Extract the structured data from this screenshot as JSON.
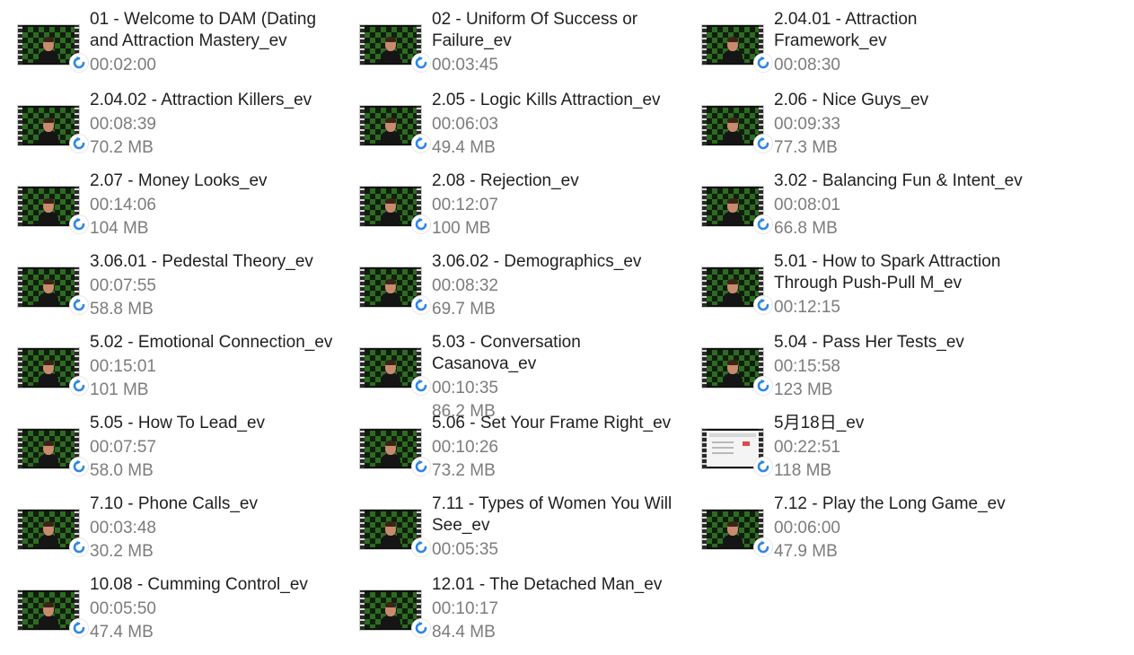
{
  "files": [
    {
      "name": "01 - Welcome to DAM (Dating and Attraction Mastery_ev",
      "duration": "00:02:00",
      "size": ""
    },
    {
      "name": "02 - Uniform Of Success or Failure_ev",
      "duration": "00:03:45",
      "size": ""
    },
    {
      "name": "2.04.01 - Attraction Framework_ev",
      "duration": "00:08:30",
      "size": ""
    },
    {
      "name": "2.04.02 - Attraction Killers_ev",
      "duration": "00:08:39",
      "size": "70.2 MB"
    },
    {
      "name": "2.05 - Logic Kills Attraction_ev",
      "duration": "00:06:03",
      "size": "49.4 MB"
    },
    {
      "name": "2.06 - Nice Guys_ev",
      "duration": "00:09:33",
      "size": "77.3 MB"
    },
    {
      "name": "2.07 - Money Looks_ev",
      "duration": "00:14:06",
      "size": "104 MB"
    },
    {
      "name": "2.08 - Rejection_ev",
      "duration": "00:12:07",
      "size": "100 MB"
    },
    {
      "name": "3.02 - Balancing Fun & Intent_ev",
      "duration": "00:08:01",
      "size": "66.8 MB"
    },
    {
      "name": "3.06.01 - Pedestal Theory_ev",
      "duration": "00:07:55",
      "size": "58.8 MB"
    },
    {
      "name": "3.06.02 - Demographics_ev",
      "duration": "00:08:32",
      "size": "69.7 MB"
    },
    {
      "name": "5.01 - How to Spark Attraction Through Push-Pull M_ev",
      "duration": "00:12:15",
      "size": ""
    },
    {
      "name": "5.02 - Emotional Connection_ev",
      "duration": "00:15:01",
      "size": "101 MB"
    },
    {
      "name": "5.03 - Conversation Casanova_ev",
      "duration": "00:10:35",
      "size": "86.2 MB"
    },
    {
      "name": "5.04 - Pass Her Tests_ev",
      "duration": "00:15:58",
      "size": "123 MB"
    },
    {
      "name": "5.05 - How To Lead_ev",
      "duration": "00:07:57",
      "size": "58.0 MB"
    },
    {
      "name": "5.06 - Set Your Frame Right_ev",
      "duration": "00:10:26",
      "size": "73.2 MB"
    },
    {
      "name": "5月18日_ev",
      "duration": "00:22:51",
      "size": "118 MB"
    },
    {
      "name": "7.10 - Phone Calls_ev",
      "duration": "00:03:48",
      "size": "30.2 MB"
    },
    {
      "name": "7.11 - Types of Women You Will See_ev",
      "duration": "00:05:35",
      "size": ""
    },
    {
      "name": "7.12 - Play the Long Game_ev",
      "duration": "00:06:00",
      "size": "47.9 MB"
    },
    {
      "name": "10.08 - Cumming Control_ev",
      "duration": "00:05:50",
      "size": "47.4 MB"
    },
    {
      "name": "12.01 - The Detached Man_ev",
      "duration": "00:10:17",
      "size": "84.4 MB"
    }
  ],
  "thumbnail_icon": "video-file-icon",
  "badge_icon": "sync-arrow-icon",
  "colors": {
    "title_text": "#1f1f1f",
    "meta_text": "#7c7c7c",
    "badge_blue": "#2f86e8"
  }
}
